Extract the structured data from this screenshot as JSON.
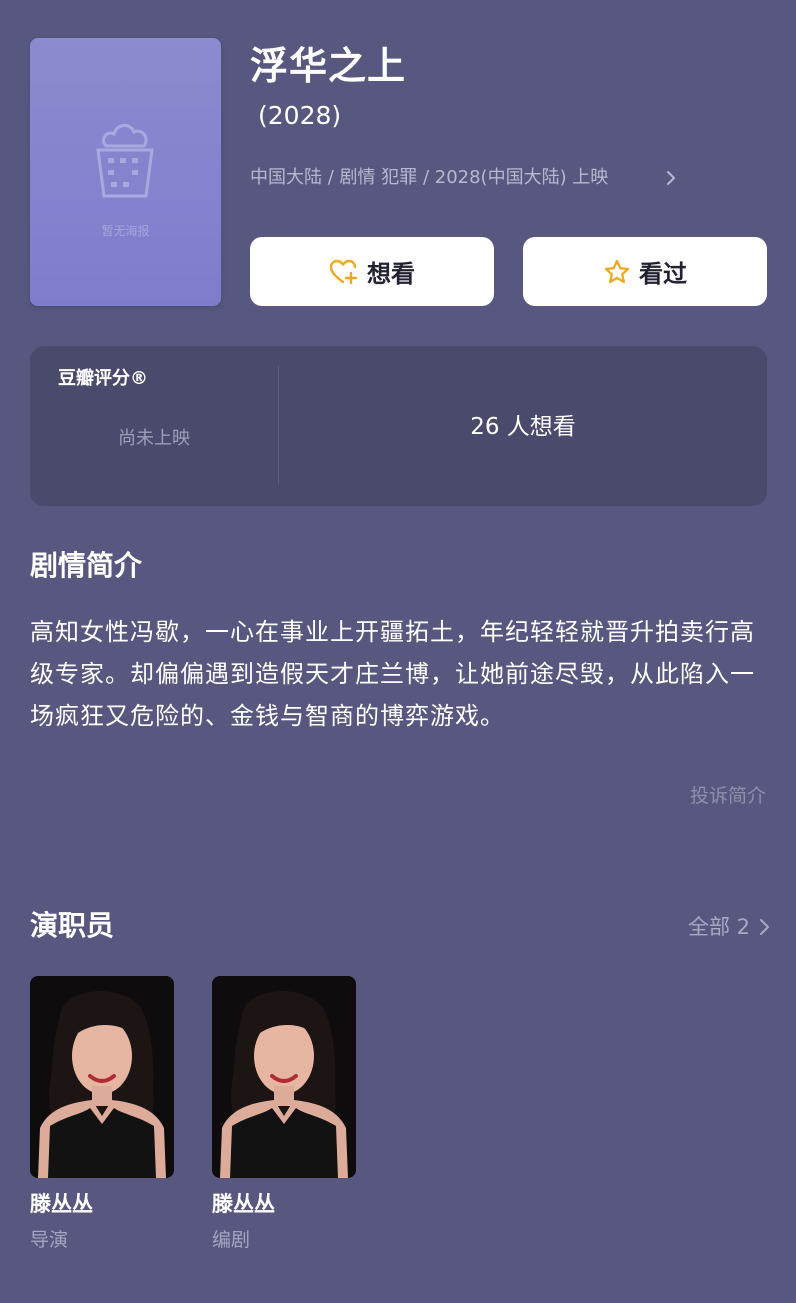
{
  "movie": {
    "title": "浮华之上",
    "year": "(2028)",
    "meta": "中国大陆 / 剧情 犯罪 / 2028(中国大陆) 上映",
    "poster_placeholder": "暂无海报"
  },
  "actions": {
    "want_label": "想看",
    "seen_label": "看过"
  },
  "rating": {
    "label": "豆瓣评分®",
    "status": "尚未上映",
    "want_count": "26 人想看"
  },
  "synopsis": {
    "title": "剧情简介",
    "text": "高知女性冯歇，一心在事业上开疆拓土，年纪轻轻就晋升拍卖行高级专家。却偏偏遇到造假天才庄兰博，让她前途尽毁，从此陷入一场疯狂又危险的、金钱与智商的博弈游戏。",
    "report_label": "投诉简介"
  },
  "cast": {
    "title": "演职员",
    "all_label": "全部 2",
    "members": [
      {
        "name": "滕丛丛",
        "role": "导演"
      },
      {
        "name": "滕丛丛",
        "role": "编剧"
      }
    ]
  },
  "colors": {
    "background": "#575780",
    "card": "#4a4a6c",
    "poster": "#8080ce",
    "accent_icon": "#f0a81e"
  },
  "icons": {
    "poster": "popcorn-icon",
    "want": "heart-plus-icon",
    "seen": "star-outline-icon",
    "chevron": "chevron-right-icon"
  }
}
